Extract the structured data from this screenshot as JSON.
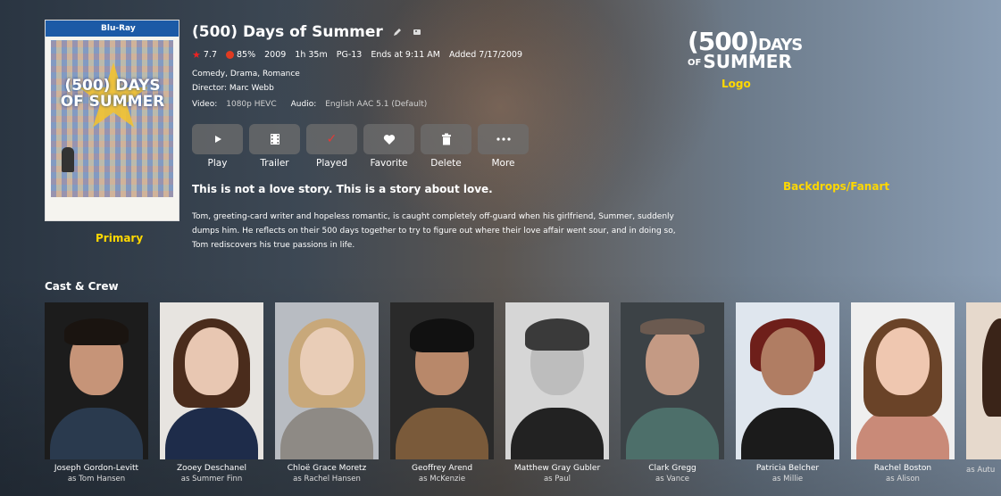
{
  "movie": {
    "title": "(500) Days of Summer",
    "rating": "7.7",
    "critic": "85%",
    "year": "2009",
    "runtime": "1h 35m",
    "certification": "PG-13",
    "ends_at": "Ends at 9:11 AM",
    "added": "Added 7/17/2009",
    "genres": "Comedy, Drama, Romance",
    "director": "Director: Marc Webb",
    "video_label": "Video:",
    "video_value": "1080p HEVC",
    "audio_label": "Audio:",
    "audio_value": "English AAC 5.1 (Default)",
    "tagline": "This is not a love story. This is a story about love.",
    "overview": "Tom, greeting-card writer and hopeless romantic, is caught completely off-guard when his girlfriend, Summer, suddenly dumps him. He reflects on their 500 days together to try to figure out where their love affair went sour, and in doing so, Tom rediscovers his true passions in life."
  },
  "poster": {
    "badge": "Blu-Ray",
    "title": "(500) DAYS OF SUMMER"
  },
  "logo": {
    "line1_num": "(500)",
    "line1_word": "DAYS",
    "line2_of": "OF",
    "line2_word": "SUMMER"
  },
  "annotations": {
    "primary": "Primary",
    "logo": "Logo",
    "backdrops": "Backdrops/Fanart"
  },
  "buttons": [
    {
      "label": "Play",
      "icon": "play-icon"
    },
    {
      "label": "Trailer",
      "icon": "film-icon"
    },
    {
      "label": "Played",
      "icon": "check-icon"
    },
    {
      "label": "Favorite",
      "icon": "heart-icon"
    },
    {
      "label": "Delete",
      "icon": "trash-icon"
    },
    {
      "label": "More",
      "icon": "more-icon"
    }
  ],
  "cast_section": {
    "title": "Cast & Crew",
    "people": [
      {
        "name": "Joseph Gordon-Levitt",
        "role": "as Tom Hansen"
      },
      {
        "name": "Zooey Deschanel",
        "role": "as Summer Finn"
      },
      {
        "name": "Chloë Grace Moretz",
        "role": "as Rachel Hansen"
      },
      {
        "name": "Geoffrey Arend",
        "role": "as McKenzie"
      },
      {
        "name": "Matthew Gray Gubler",
        "role": "as Paul"
      },
      {
        "name": "Clark Gregg",
        "role": "as Vance"
      },
      {
        "name": "Patricia Belcher",
        "role": "as Millie"
      },
      {
        "name": "Rachel Boston",
        "role": "as Alison"
      },
      {
        "name": "",
        "role": "as Autu"
      }
    ]
  },
  "colors": {
    "annotation": "#ffd800",
    "played_check": "#e53935",
    "rating_star": "#e22222"
  }
}
